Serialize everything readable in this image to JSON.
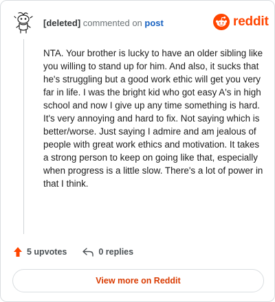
{
  "comment": {
    "author": "[deleted]",
    "action_text": "commented on",
    "post_link": "post",
    "body": "NTA. Your brother is lucky to have an older sibling like you willing to stand up for him. And also, it sucks that he's struggling but a good work ethic will get you very far in life. I was the bright kid who got easy A's in high school and now I give up any time something is hard. It's very annoying and hard to fix. Not saying which is better/worse. Just saying I admire and am jealous of people with great work ethics and motivation. It takes a strong person to keep on going like that, especially when progress is a little slow. There's a lot of power in that I think."
  },
  "brand": {
    "name": "reddit",
    "color": "#ff4500"
  },
  "actions": {
    "upvotes": "5 upvotes",
    "replies": "0 replies"
  },
  "view_more": {
    "label": "View more on Reddit"
  }
}
